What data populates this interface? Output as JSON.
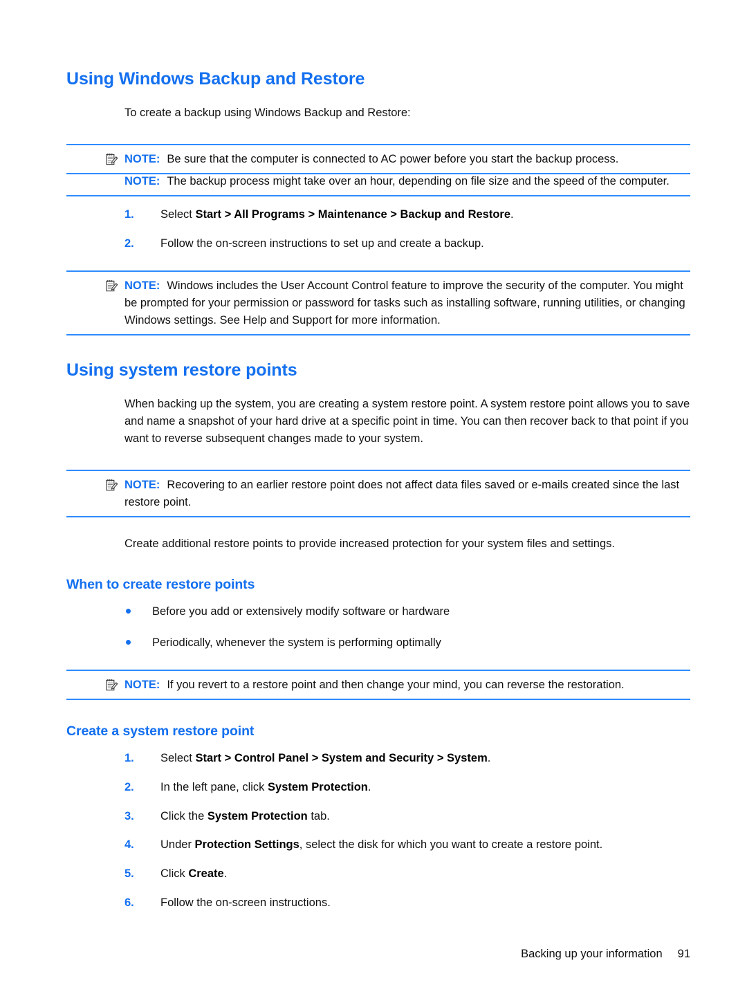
{
  "colors": {
    "heading_blue": "#1470ef",
    "rule_blue": "#2e8bff",
    "text_black": "#111111"
  },
  "sections": {
    "backup_restore": {
      "heading": "Using Windows Backup and Restore",
      "intro": "To create a backup using Windows Backup and Restore:",
      "note1": {
        "label": "NOTE:",
        "text": "Be sure that the computer is connected to AC power before you start the backup process.",
        "icon": "note-pencil-icon"
      },
      "note2": {
        "label": "NOTE:",
        "text": "The backup process might take over an hour, depending on file size and the speed of the computer."
      },
      "steps": [
        {
          "num": "1.",
          "pre": "Select ",
          "bold": "Start > All Programs > Maintenance > Backup and Restore",
          "post": "."
        },
        {
          "num": "2.",
          "pre": "Follow the on-screen instructions to set up and create a backup.",
          "bold": "",
          "post": ""
        }
      ],
      "note3": {
        "label": "NOTE:",
        "text": "Windows includes the User Account Control feature to improve the security of the computer. You might be prompted for your permission or password for tasks such as installing software, running utilities, or changing Windows settings. See Help and Support for more information.",
        "icon": "note-pencil-icon"
      }
    },
    "restore_points": {
      "heading": "Using system restore points",
      "paragraph": "When backing up the system, you are creating a system restore point. A system restore point allows you to save and name a snapshot of your hard drive at a specific point in time. You can then recover back to that point if you want to reverse subsequent changes made to your system.",
      "note1": {
        "label": "NOTE:",
        "text": "Recovering to an earlier restore point does not affect data files saved or e-mails created since the last restore point.",
        "icon": "note-pencil-icon"
      },
      "paragraph2": "Create additional restore points to provide increased protection for your system files and settings."
    },
    "when_to_create": {
      "heading": "When to create restore points",
      "bullets": [
        "Before you add or extensively modify software or hardware",
        "Periodically, whenever the system is performing optimally"
      ],
      "note1": {
        "label": "NOTE:",
        "text": "If you revert to a restore point and then change your mind, you can reverse the restoration.",
        "icon": "note-pencil-icon"
      }
    },
    "create_restore_point": {
      "heading": "Create a system restore point",
      "steps": [
        {
          "num": "1.",
          "pre": "Select ",
          "bold": "Start > Control Panel > System and Security > System",
          "post": "."
        },
        {
          "num": "2.",
          "pre": "In the left pane, click ",
          "bold": "System Protection",
          "post": "."
        },
        {
          "num": "3.",
          "pre": "Click the ",
          "bold": "System Protection",
          "post": " tab."
        },
        {
          "num": "4.",
          "pre": "Under ",
          "bold": "Protection Settings",
          "post": ", select the disk for which you want to create a restore point."
        },
        {
          "num": "5.",
          "pre": "Click ",
          "bold": "Create",
          "post": "."
        },
        {
          "num": "6.",
          "pre": "Follow the on-screen instructions.",
          "bold": "",
          "post": ""
        }
      ]
    }
  },
  "footer": {
    "title": "Backing up your information",
    "page_number": "91"
  }
}
